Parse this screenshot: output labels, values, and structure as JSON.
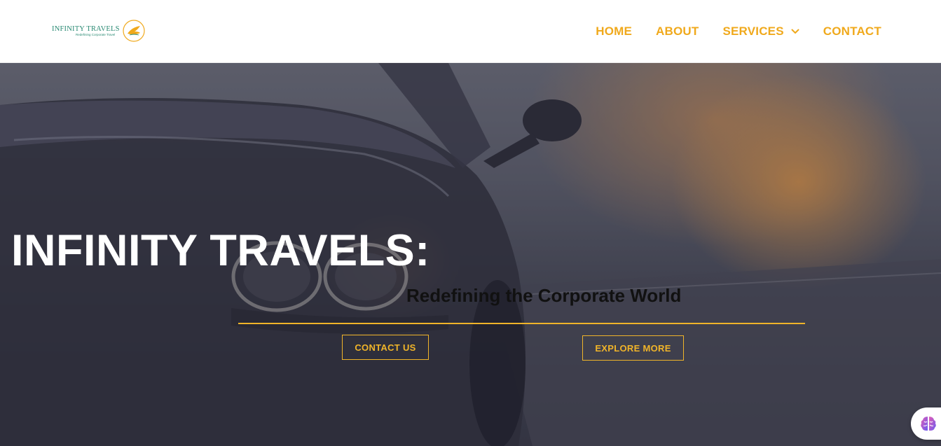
{
  "brand": {
    "name": "INFINITY TRAVELS",
    "tagline": "Redefining Corporate Travel",
    "emblem_icon": "plane-emblem-icon"
  },
  "nav": {
    "items": [
      {
        "label": "HOME"
      },
      {
        "label": "ABOUT"
      },
      {
        "label": "SERVICES",
        "has_dropdown": true
      },
      {
        "label": "CONTACT"
      }
    ]
  },
  "hero": {
    "title": "INFINITY TRAVELS:",
    "subtitle": "Redefining the Corporate World",
    "contact_button": "CONTACT US",
    "explore_button": "EXPLORE MORE"
  },
  "assistant": {
    "icon": "brain-icon"
  },
  "colors": {
    "accent": "#f0a91c",
    "brand_green": "#2a8a73",
    "title_text": "#ffffff",
    "subtitle_text": "#111111"
  }
}
